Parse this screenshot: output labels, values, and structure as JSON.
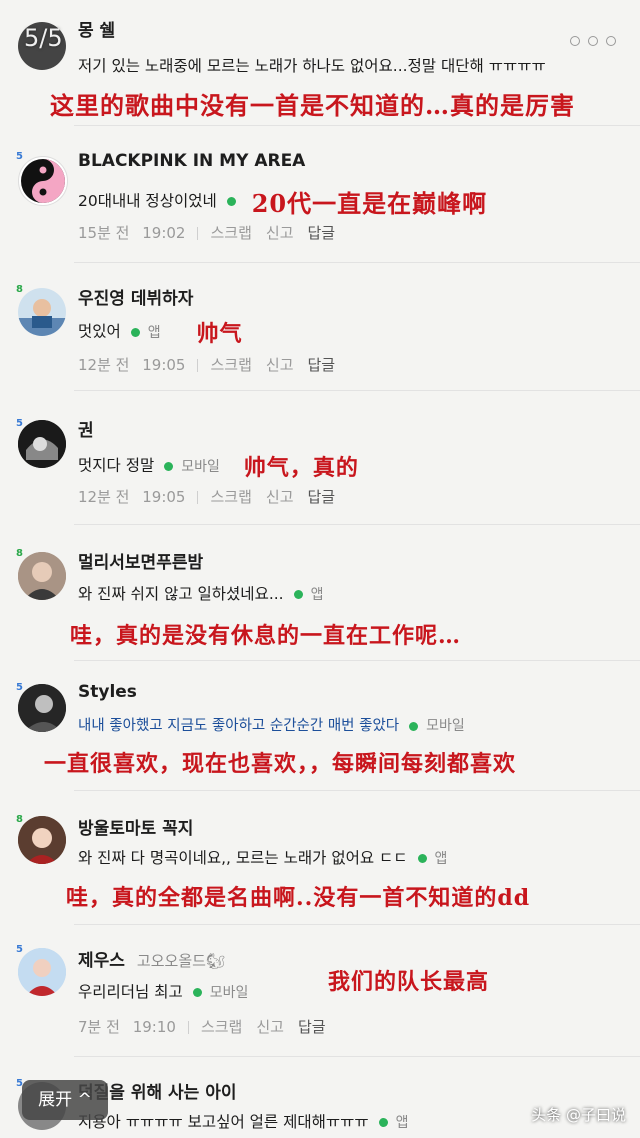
{
  "viewer": {
    "page_counter": "5/5",
    "expand_label": "展开 ^",
    "watermark": "头条 @子曰说"
  },
  "comments": [
    {
      "badge": "5",
      "username": "몽 쉘",
      "text": "저기 있는 노래중에 모르는 노래가 하나도 없어요...정말 대단해 ㅠㅠㅠㅠ",
      "translation": "这里的歌曲中没有一首是不知道的…真的是厉害"
    },
    {
      "badge": "5",
      "username": "BLACKPINK IN MY AREA",
      "text": "20대내내 정상이었네",
      "translation": "20代一直是在巅峰啊",
      "time_ago": "15분 전",
      "time": "19:02",
      "scrap": "스크랩",
      "report": "신고",
      "reply": "답글"
    },
    {
      "badge": "8",
      "username": "우진영 데뷔하자",
      "text": "멋있어",
      "source": "앱",
      "translation": "帅气",
      "time_ago": "12분 전",
      "time": "19:05",
      "scrap": "스크랩",
      "report": "신고",
      "reply": "답글"
    },
    {
      "badge": "5",
      "username": "권",
      "text": "멋지다 정말",
      "source": "모바일",
      "translation": "帅气，真的",
      "time_ago": "12분 전",
      "time": "19:05",
      "scrap": "스크랩",
      "report": "신고",
      "reply": "답글"
    },
    {
      "badge": "8",
      "username": "멀리서보면푸른밤",
      "text": "와 진짜 쉬지 않고 일하셨네요...",
      "source": "앱",
      "translation": "哇，真的是没有休息的一直在工作呢…"
    },
    {
      "badge": "5",
      "username": "Styles",
      "text": "내내 좋아했고 지금도 좋아하고 순간순간 매번 좋았다",
      "source": "모바일",
      "translation": "一直很喜欢，现在也喜欢，，每瞬间每刻都喜欢"
    },
    {
      "badge": "8",
      "username": "방울토마토 꼭지",
      "text": "와 진짜 다 명곡이네요,, 모르는 노래가 없어요 ㄷㄷ",
      "source": "앱",
      "translation": "哇，真的全都是名曲啊..没有一首不知道的dd"
    },
    {
      "badge": "5",
      "username": "제우스",
      "user_tag": "고오오올드🐿",
      "text": "우리리더님 최고",
      "source": "모바일",
      "translation": "我们的队长最高",
      "time_ago": "7분 전",
      "time": "19:10",
      "scrap": "스크랩",
      "report": "신고",
      "reply": "답글"
    },
    {
      "badge": "5",
      "username": "덕질을 위해 사는 아이",
      "text": "지용아 ㅠㅠㅠㅠ 보고싶어 얼른 제대해ㅠㅠㅠ",
      "source": "앱"
    }
  ]
}
